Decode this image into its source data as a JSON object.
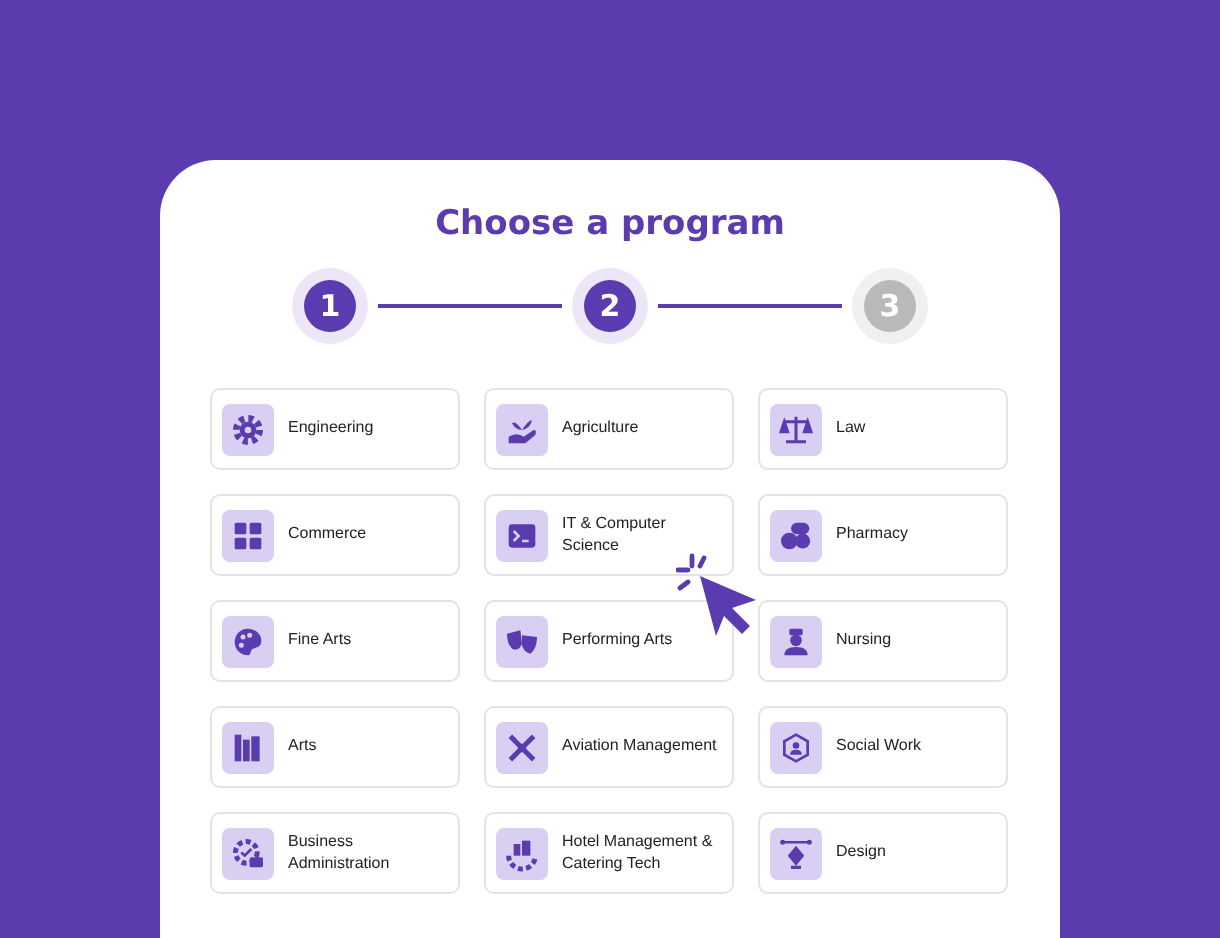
{
  "title": "Choose a program",
  "steps": [
    {
      "label": "1",
      "active": true
    },
    {
      "label": "2",
      "active": true
    },
    {
      "label": "3",
      "active": false
    }
  ],
  "program_rows": [
    {
      "programs": [
        {
          "label": "Engineering"
        },
        {
          "label": "Agriculture"
        },
        {
          "label": "Law"
        }
      ]
    },
    {
      "programs": [
        {
          "label": "Commerce"
        },
        {
          "label": "IT & Computer Science"
        },
        {
          "label": "Pharmacy"
        }
      ]
    },
    {
      "programs": [
        {
          "label": "Fine Arts"
        },
        {
          "label": "Performing Arts"
        },
        {
          "label": "Nursing"
        }
      ]
    },
    {
      "programs": [
        {
          "label": "Arts"
        },
        {
          "label": "Aviation Management"
        },
        {
          "label": "Social Work"
        }
      ]
    },
    {
      "programs": [
        {
          "label": "Business Administration"
        },
        {
          "label": "Hotel Management & Catering Tech"
        },
        {
          "label": "Design"
        }
      ]
    }
  ]
}
